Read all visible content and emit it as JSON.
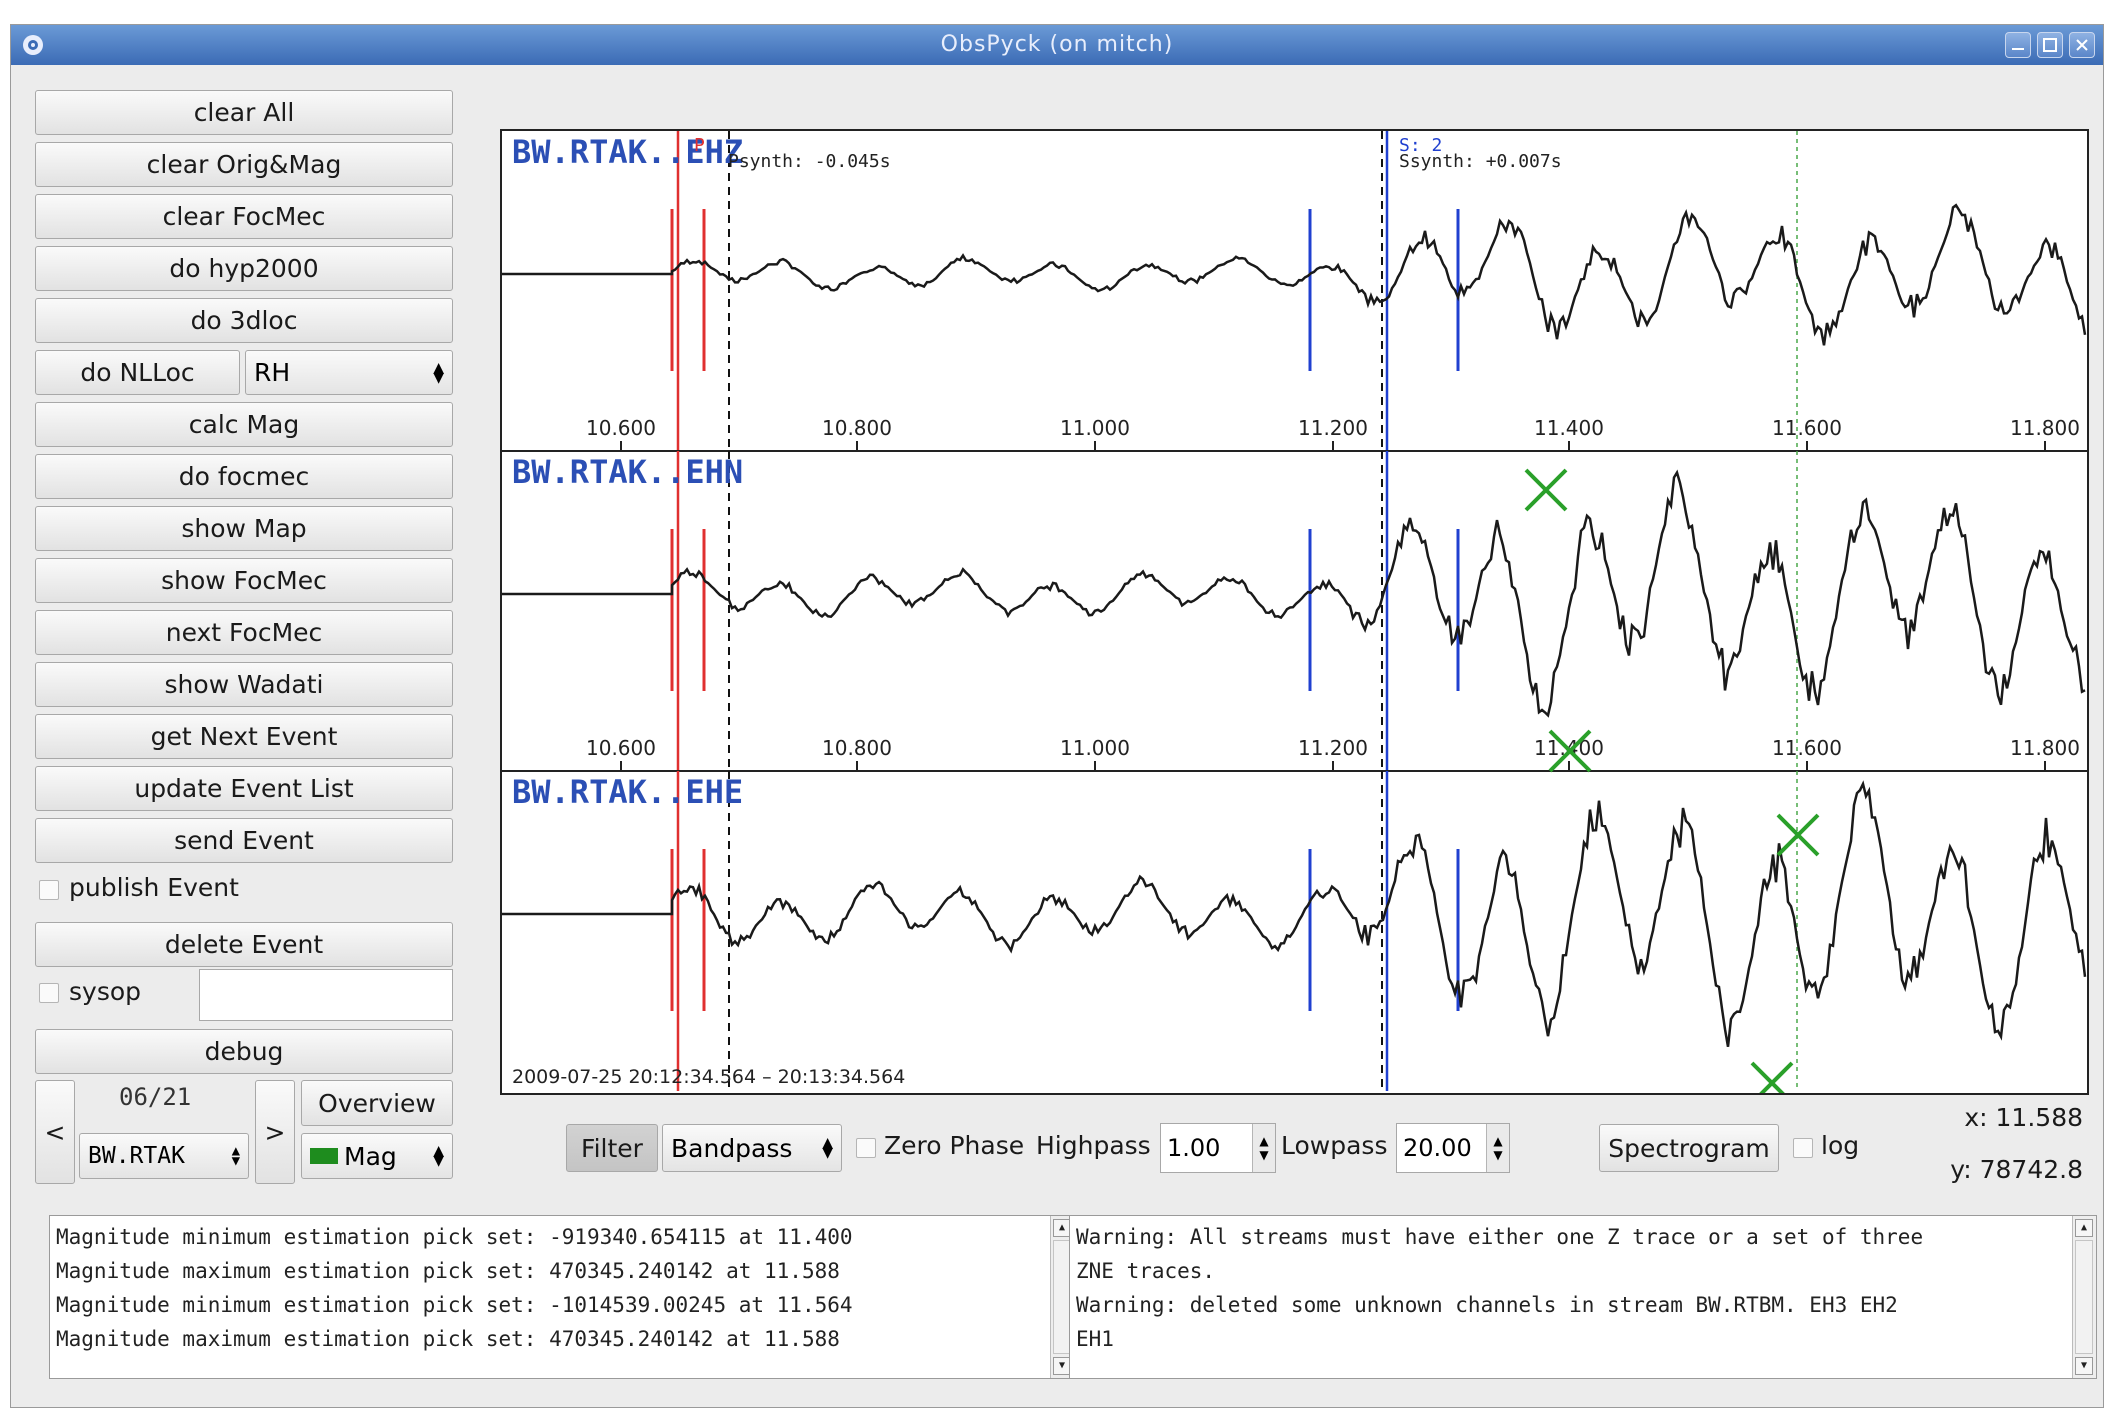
{
  "window": {
    "title": "ObsPyck (on mitch)"
  },
  "sidebar": {
    "buttons": [
      "clear All",
      "clear Orig&Mag",
      "clear FocMec",
      "do hyp2000",
      "do 3dloc"
    ],
    "nlloc_button": "do NLLoc",
    "nlloc_combo": "RH",
    "buttons2": [
      "calc Mag",
      "do focmec",
      "show Map",
      "show FocMec",
      "next FocMec",
      "show Wadati",
      "get Next Event",
      "update Event List",
      "send Event"
    ],
    "publish_label": "publish Event",
    "delete_button": "delete Event",
    "sysop_label": "sysop",
    "sysop_value": "",
    "debug_button": "debug",
    "prev_button": "<",
    "next_button": ">",
    "counter": "06/21",
    "station_combo": "BW.RTAK",
    "overview_button": "Overview",
    "mag_combo": "Mag",
    "mag_color": "#1e8c1e"
  },
  "toolbar": {
    "filter_button": "Filter",
    "filter_type": "Bandpass",
    "zero_phase_label": "Zero Phase",
    "highpass_label": "Highpass",
    "highpass_value": "1.00",
    "lowpass_label": "Lowpass",
    "lowpass_value": "20.00",
    "spectrogram_button": "Spectrogram",
    "log_label": "log",
    "x_readout": "x: 11.588",
    "y_readout": "y: 78742.8"
  },
  "plots": {
    "traces": [
      {
        "name": "BW.RTAK..EHZ",
        "p_label": "P",
        "s_label": "S: 2",
        "psynth": "Psynth: -0.045s",
        "ssynth": "Ssynth: +0.007s"
      },
      {
        "name": "BW.RTAK..EHN"
      },
      {
        "name": "BW.RTAK..EHE"
      }
    ],
    "x_ticks": [
      "10.600",
      "10.800",
      "11.000",
      "11.200",
      "11.400",
      "11.600",
      "11.800"
    ],
    "time_range": "2009-07-25  20:12:34.564 – 20:13:34.564",
    "colors": {
      "trace": "#1a1a1a",
      "p_pick": "#e03030",
      "s_pick": "#2040d0",
      "name": "#2b4fb5",
      "mag_marker": "#2aa02a",
      "mag_line": "#4aa84a"
    }
  },
  "log_left": [
    "Magnitude minimum estimation pick set: -919340.654115 at 11.400",
    "Magnitude maximum estimation pick set: 470345.240142 at 11.588",
    "Magnitude minimum estimation pick set: -1014539.00245 at 11.564",
    "Magnitude maximum estimation pick set: 470345.240142 at 11.588"
  ],
  "log_right": [
    "Warning: All streams must have either one Z trace or a set of three",
    "ZNE traces.",
    "Warning: deleted some unknown channels in stream BW.RTBM. EH3 EH2",
    "EH1"
  ]
}
